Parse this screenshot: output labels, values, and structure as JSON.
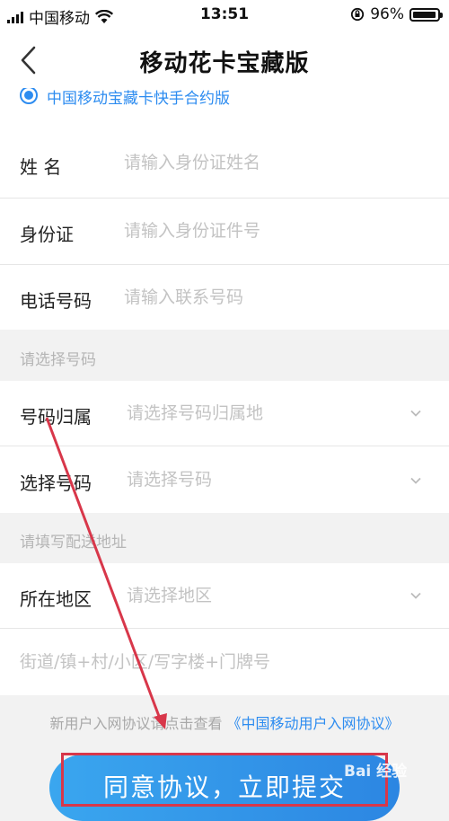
{
  "status_bar": {
    "carrier": "中国移动",
    "time": "13:51",
    "battery": "96%",
    "battery_level": 0.96
  },
  "nav": {
    "title": "移动花卡宝藏版",
    "back_icon": "chevron-left-icon"
  },
  "plan": {
    "label": "中国移动宝藏卡快手合约版",
    "selected": true
  },
  "form": {
    "name": {
      "label": "姓 名",
      "placeholder": "请输入身份证姓名"
    },
    "id_card": {
      "label": "身份证",
      "placeholder": "请输入身份证件号"
    },
    "phone": {
      "label": "电话号码",
      "placeholder": "请输入联系号码"
    },
    "section_number": "请选择号码",
    "number_location": {
      "label": "号码归属",
      "placeholder": "请选择号码归属地"
    },
    "choose_number": {
      "label": "选择号码",
      "placeholder": "请选择号码"
    },
    "section_address": "请填写配送地址",
    "region": {
      "label": "所在地区",
      "placeholder": "请选择地区"
    },
    "street": {
      "placeholder": "街道/镇+村/小区/写字楼+门牌号"
    }
  },
  "agreement": {
    "prefix": "新用户入网协议请点击查看",
    "link": "《中国移动用户入网协议》"
  },
  "submit_label": "同意协议，立即提交",
  "watermark": "Bai 经验",
  "colors": {
    "accent": "#2d8cf0",
    "button_start": "#3aa6ef",
    "button_end": "#2c86e2",
    "annotation": "#d8374a"
  }
}
